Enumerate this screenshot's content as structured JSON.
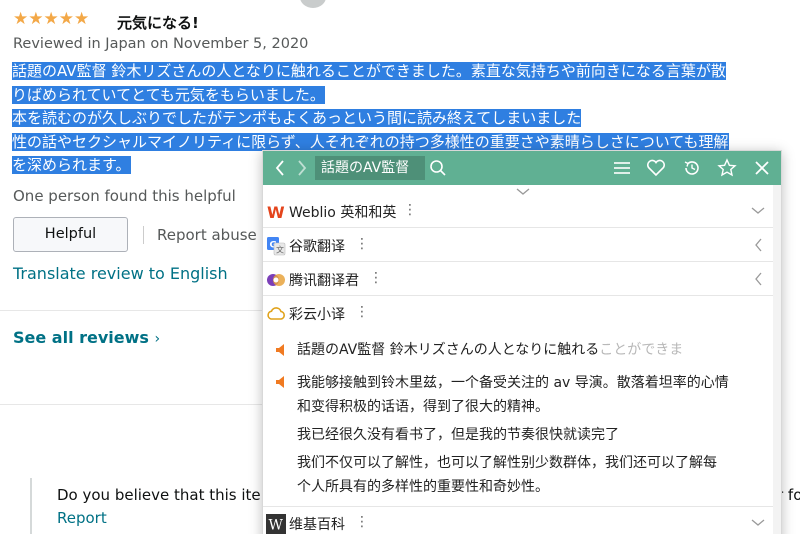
{
  "review": {
    "stars": "★★★★★",
    "title": "元気になる!",
    "meta": "Reviewed in Japan on November 5, 2020",
    "body_lines": [
      "話題のAV監督 鈴木リズさんの人となりに触れることができました。素直な気持ちや前向きになる言葉が散",
      "りばめられていてとても元気をもらいました。",
      "本を読むのが久しぶりでしたがテンポもよくあっという間に読み終えてしまいました",
      "性の話やセクシャルマイノリティに限らず、人それぞれの持つ多様性の重要さや素晴らしさについても理解",
      "を深められます。"
    ],
    "helpful_count": "One person found this helpful",
    "helpful_button": "Helpful",
    "report_abuse": "Report abuse",
    "translate_link": "Translate review to English",
    "see_all": "See all reviews",
    "see_all_chevron": "›"
  },
  "feedback": {
    "question": "Do you believe that this ite",
    "question_tail": "r fo",
    "report": "Report"
  },
  "popup": {
    "toolbar": {
      "back_icon": "‹",
      "forward_icon": "›",
      "query": "話題のAV監督",
      "search_icon": "search-icon",
      "menu_icon": "menu-icon",
      "favorite_icon": "heart-icon",
      "history_icon": "history-icon",
      "pin_icon": "pin-icon",
      "close_icon": "close-icon",
      "accent": "#60b093"
    },
    "dictionaries": [
      {
        "name": "Weblio 英和和英",
        "icon": "W",
        "menu": "⋮"
      },
      {
        "name": "谷歌翻译",
        "icon": "G",
        "menu": "⋮"
      },
      {
        "name": "腾讯翻译君",
        "icon": "tencent-icon",
        "menu": "⋮"
      },
      {
        "name": "彩云小译",
        "icon": "cloud-icon",
        "menu": "⋮"
      },
      {
        "name": "维基百科",
        "icon": "W",
        "menu": "⋮"
      }
    ],
    "caiyun": {
      "source_bright": "話題のAV監督 鈴木リズさんの人となりに触れる",
      "source_faded": "ことができま",
      "translation_lines": [
        "我能够接触到铃木里兹，一个备受关注的 av 导演。散落着坦率的心情",
        "和变得积极的话语，得到了很大的精神。",
        "我已经很久没有看书了，但是我的节奏很快就读完了",
        "我们不仅可以了解性，也可以了解性别少数群体，我们还可以了解每",
        "个人所具有的多样性的重要性和奇妙性。"
      ]
    }
  }
}
